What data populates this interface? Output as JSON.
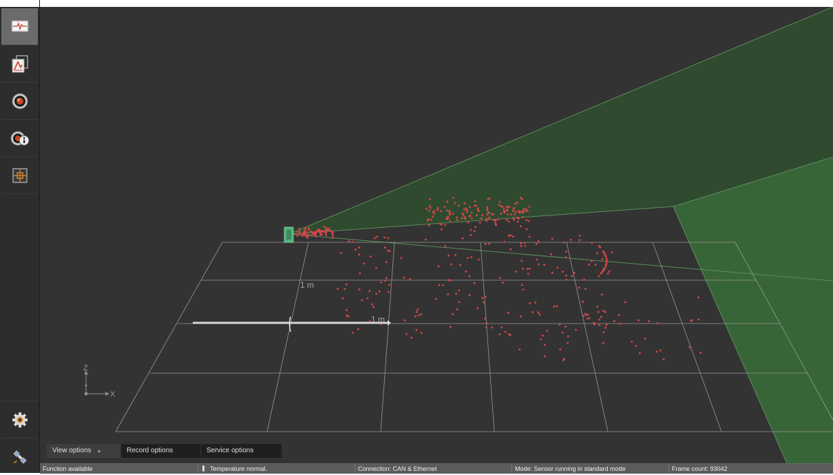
{
  "sidebar": {
    "items": [
      {
        "name": "live-view",
        "icon": "monitor-waveform-icon",
        "active": true
      },
      {
        "name": "recorded-data",
        "icon": "graph-document-icon",
        "active": false
      },
      {
        "name": "sensor",
        "icon": "radar-sensor-icon",
        "active": false
      },
      {
        "name": "sensor-info",
        "icon": "sensor-info-icon",
        "active": false
      },
      {
        "name": "calibration",
        "icon": "crosshair-target-icon",
        "active": false
      }
    ],
    "bottom": [
      {
        "name": "settings",
        "icon": "gear-icon"
      },
      {
        "name": "connection",
        "icon": "satellite-icon"
      }
    ]
  },
  "viewport": {
    "axis_z": "Z",
    "axis_x": "X",
    "scale_label_depth": "1 m",
    "scale_label_width": "1 m",
    "colors": {
      "background": "#333333",
      "grid": "#9a9a9a",
      "field_of_view": "#2e5a2e",
      "points": "#d24848",
      "sensor": "#52b07a"
    }
  },
  "tabs": [
    {
      "label": "View options",
      "active": true,
      "caret": "▲"
    },
    {
      "label": "Record options",
      "active": false
    },
    {
      "label": "Service options",
      "active": false
    }
  ],
  "status": {
    "function": "Function available",
    "temperature": "Temperature normal.",
    "connection": "Connection: CAN & Ethernet",
    "mode": "Mode: Sensor running in standard mode",
    "frame_count": "Frame count: 93042"
  }
}
